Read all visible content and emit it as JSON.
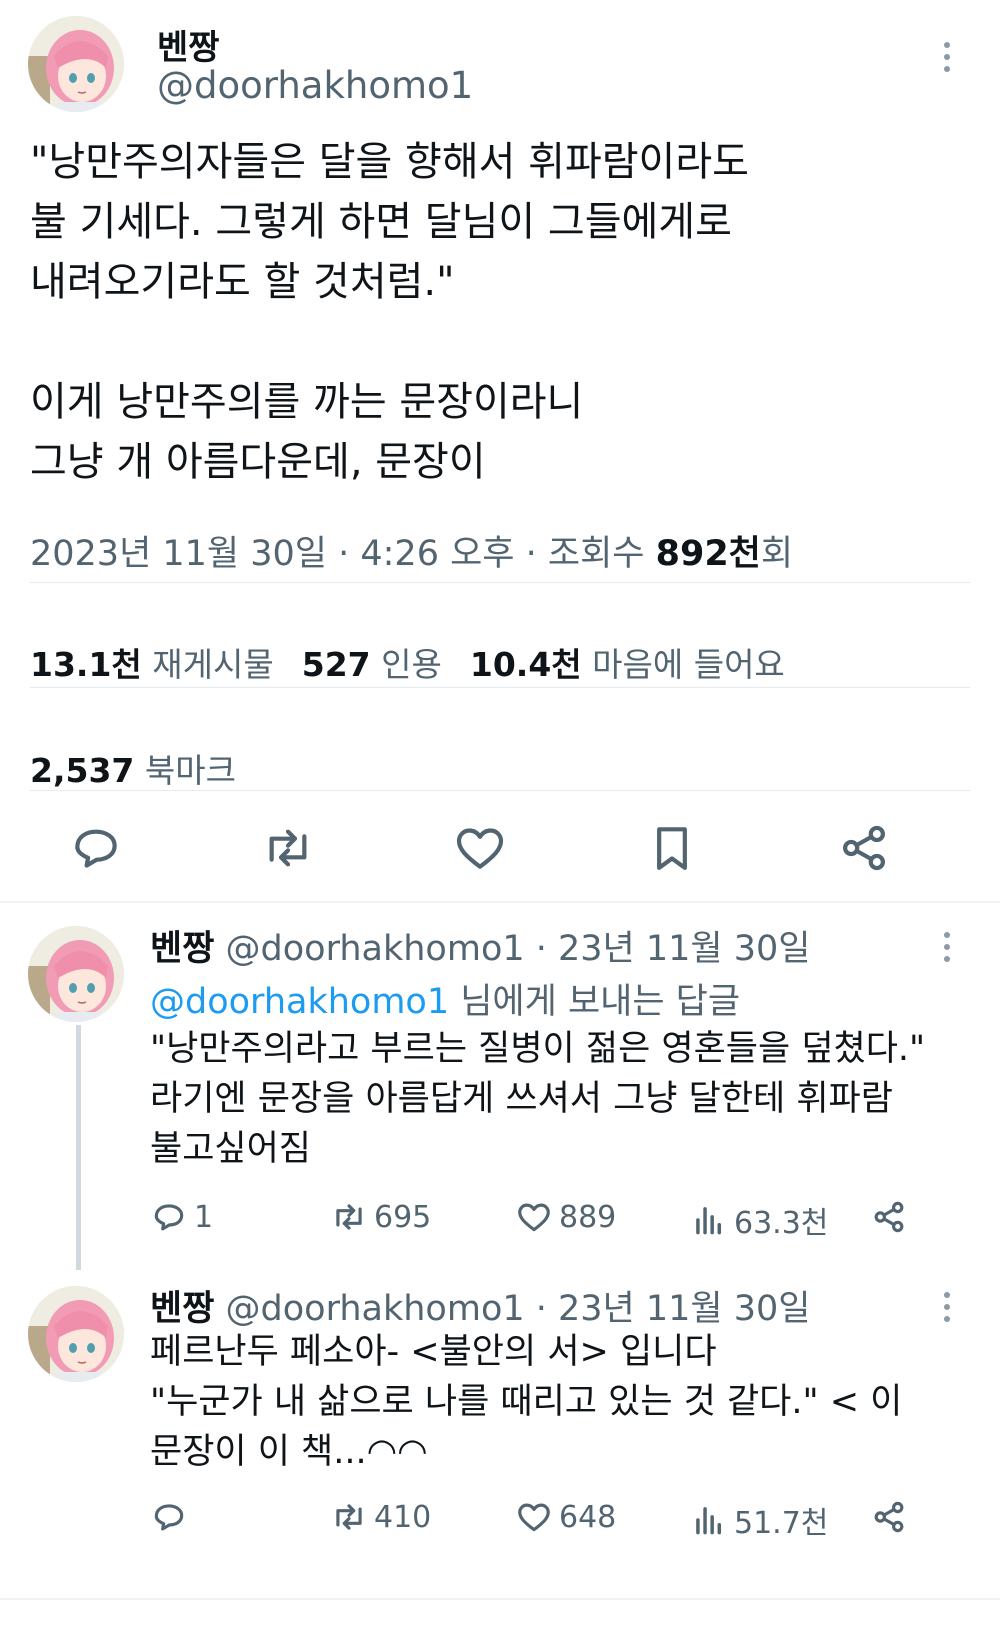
{
  "main": {
    "name": "벤짱",
    "handle": "@doorhakhomo1",
    "text_lines": [
      "\"낭만주의자들은 달을 향해서 휘파람이라도",
      "불 기세다. 그렇게 하면 달님이 그들에게로",
      "내려오기라도 할 것처럼.\"",
      "",
      "이게 낭만주의를 까는 문장이라니",
      "그냥 개 아름다운데, 문장이"
    ],
    "meta_date": "2023년 11월 30일 · 4:26 오후 · 조회수 ",
    "views_value": "892천",
    "views_suffix": "회",
    "stats": {
      "retweets_value": "13.1천",
      "retweets_label": "재게시물",
      "quotes_value": "527",
      "quotes_label": "인용",
      "likes_value": "10.4천",
      "likes_label": "마음에 들어요",
      "bookmarks_value": "2,537",
      "bookmarks_label": "북마크"
    },
    "actions": [
      "reply-icon",
      "retweet-icon",
      "heart-icon",
      "bookmark-icon",
      "share-icon"
    ]
  },
  "replies": [
    {
      "name": "벤짱",
      "handle_date": " @doorhakhomo1 · 23년 11월 30일",
      "replying_handle": "@doorhakhomo1",
      "replying_suffix": " 님에게 보내는 답글",
      "text_lines": [
        "\"낭만주의라고 부르는 질병이 젊은 영혼들을 덮쳤다.\"",
        "라기엔 문장을 아름답게 쓰셔서 그냥 달한테 휘파람",
        "불고싶어짐"
      ],
      "replies": "1",
      "retweets": "695",
      "likes": "889",
      "views": "63.3천"
    },
    {
      "name": "벤짱",
      "handle_date": " @doorhakhomo1 · 23년 11월 30일",
      "text_lines": [
        "페르난두 페소아- <불안의 서> 입니다",
        "\"누군가 내 삶으로 나를 때리고 있는 것 같다.\" < 이",
        "문장이 이 책...◠◠"
      ],
      "replies": "",
      "retweets": "410",
      "likes": "648",
      "views": "51.7천"
    }
  ],
  "colors": {
    "text": "#0f1419",
    "muted": "#536471",
    "link": "#1d9bf0",
    "divider": "#e6ebef",
    "avatar_hair": "#f29bb5"
  }
}
